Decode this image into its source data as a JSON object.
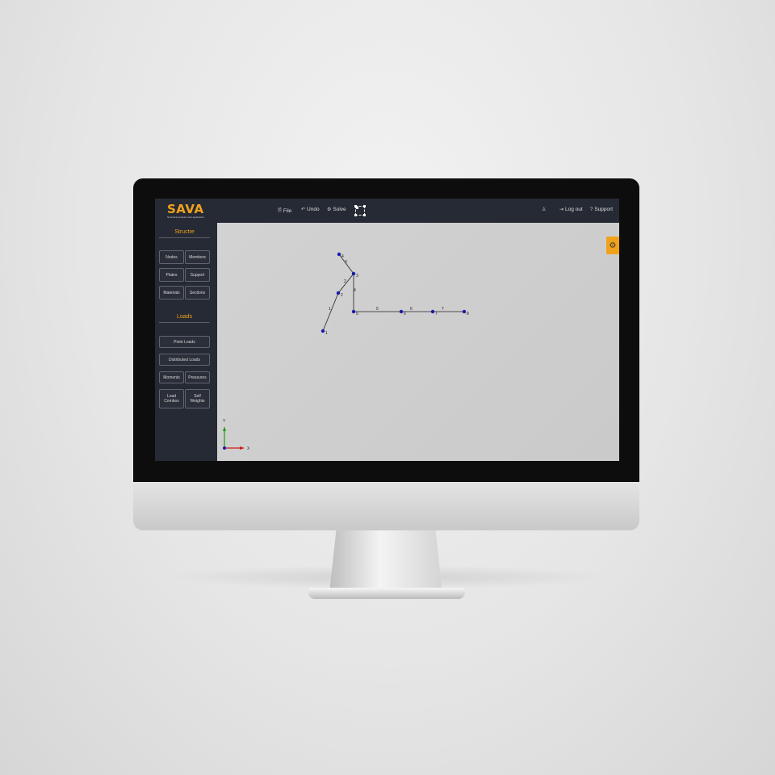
{
  "app": {
    "logo_text": "SAVA",
    "logo_subtitle": "Structural analysis web application"
  },
  "topbar": {
    "file_label": "File",
    "undo_label": "Undo",
    "solve_label": "Solve",
    "logout_label": "Log out",
    "support_label": "Support"
  },
  "sidebar": {
    "structure_title": "Structre",
    "structure_buttons": [
      "Nodes",
      "Members",
      "Plates",
      "Support",
      "Materials",
      "Sections"
    ],
    "loads_title": "Loads",
    "point_loads": "Point Loads",
    "distributed_loads": "Distributed Loads",
    "moments": "Moments",
    "pressures": "Pressures",
    "load_combos": "Load Combos",
    "self_weights": "Self Weights"
  },
  "model": {
    "nodes": [
      {
        "id": "1"
      },
      {
        "id": "2"
      },
      {
        "id": "3"
      },
      {
        "id": "4"
      },
      {
        "id": "5"
      },
      {
        "id": "6"
      },
      {
        "id": "7"
      },
      {
        "id": "8"
      }
    ],
    "members": [
      {
        "id": "1"
      },
      {
        "id": "2"
      },
      {
        "id": "3"
      },
      {
        "id": "4"
      },
      {
        "id": "5"
      },
      {
        "id": "6"
      },
      {
        "id": "7"
      }
    ]
  },
  "axes": {
    "x_label": "X",
    "y_label": "Y"
  },
  "colors": {
    "accent": "#f0a21b",
    "panel": "#262a34",
    "node": "#1a1aa8",
    "x_axis": "#d01818",
    "y_axis": "#18a018"
  }
}
